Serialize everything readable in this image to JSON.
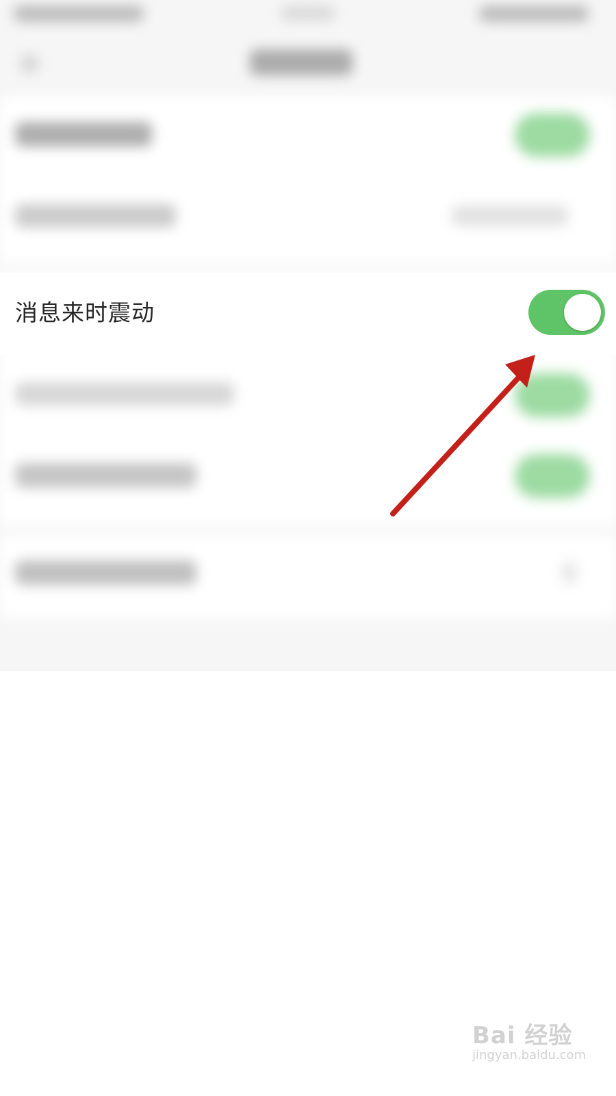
{
  "settings": {
    "highlighted_item": {
      "label": "消息来时震动",
      "toggle": {
        "state": "on",
        "on_color": "#5fc467"
      }
    }
  },
  "annotation": {
    "arrow_color": "#c4201a"
  },
  "watermark": {
    "brand": "Bai 经验",
    "url": "jingyan.baidu.com"
  }
}
